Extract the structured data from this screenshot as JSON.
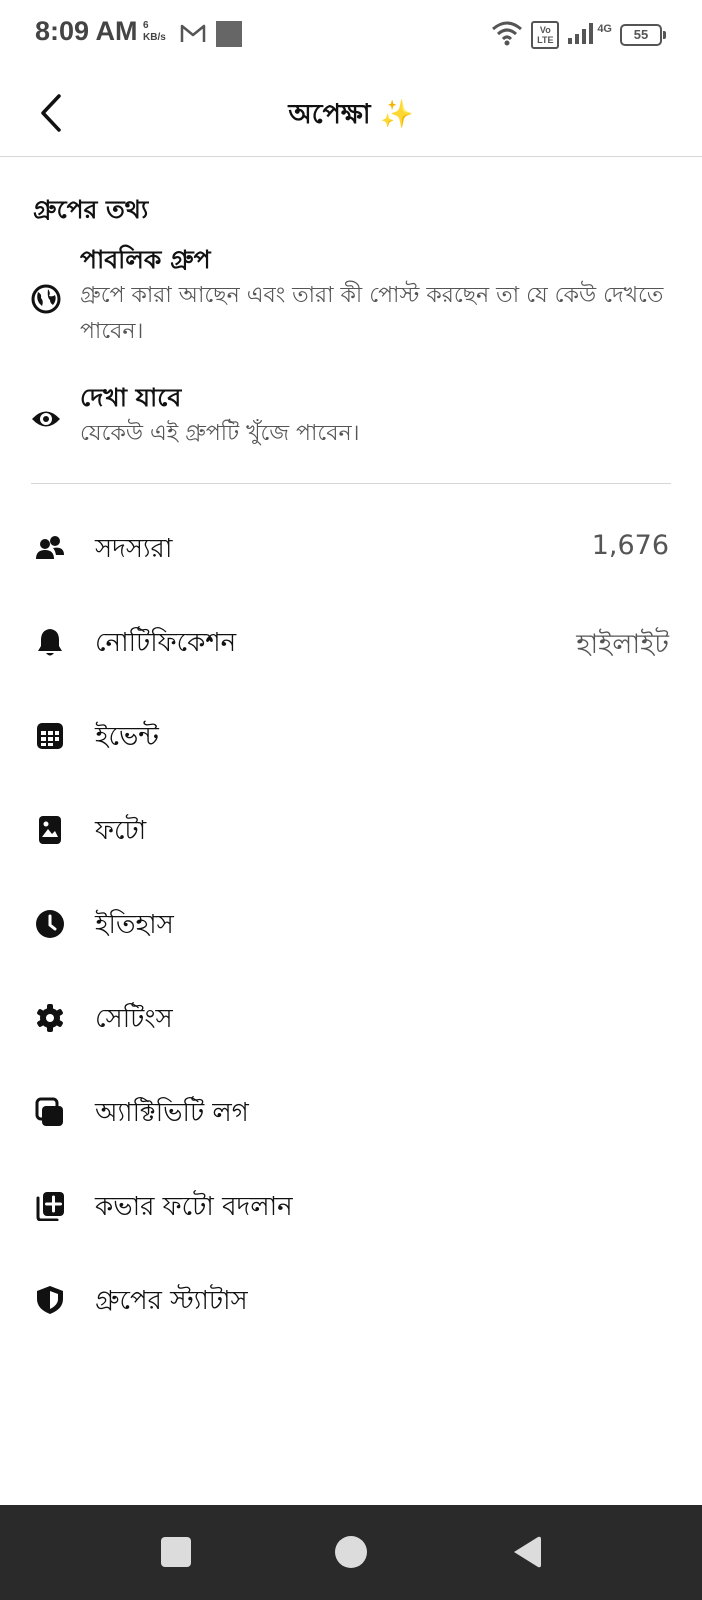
{
  "status_bar": {
    "time": "8:09 AM",
    "speed_value": "6",
    "speed_unit": "KB/s",
    "battery": "55",
    "network_4g": "4G",
    "volte": "Vo LTE"
  },
  "header": {
    "title": "অপেক্ষা ✨"
  },
  "group_info": {
    "section_title": "গ্রুপের তথ্য",
    "privacy": {
      "title": "পাবলিক গ্রুপ",
      "description": "গ্রুপে কারা আছেন এবং তারা কী পোস্ট করছেন তা যে কেউ দেখতে পাবেন।",
      "icon": "globe-icon"
    },
    "visibility": {
      "title": "দেখা যাবে",
      "description": "যেকেউ এই গ্রুপটি খুঁজে পাবেন।",
      "icon": "eye-icon"
    }
  },
  "menu": {
    "members": {
      "label": "সদস্যরা",
      "value": "1,676",
      "icon": "members-icon"
    },
    "notifications": {
      "label": "নোটিফিকেশন",
      "value": "হাইলাইট",
      "icon": "bell-icon"
    },
    "events": {
      "label": "ইভেন্ট",
      "icon": "calendar-icon"
    },
    "photos": {
      "label": "ফটো",
      "icon": "photo-icon"
    },
    "history": {
      "label": "ইতিহাস",
      "icon": "clock-icon"
    },
    "settings": {
      "label": "সেটিংস",
      "icon": "gear-icon"
    },
    "activity_log": {
      "label": "অ্যাক্টিভিটি লগ",
      "icon": "activity-log-icon"
    },
    "cover_photo": {
      "label": "কভার ফটো বদলান",
      "icon": "add-photo-icon"
    },
    "group_status": {
      "label": "গ্রুপের স্ট্যাটাস",
      "icon": "shield-icon"
    }
  },
  "colors": {
    "background": "#ffffff",
    "text_primary": "#111111",
    "text_secondary": "#555555",
    "nav_bar": "#2a2a2a"
  }
}
